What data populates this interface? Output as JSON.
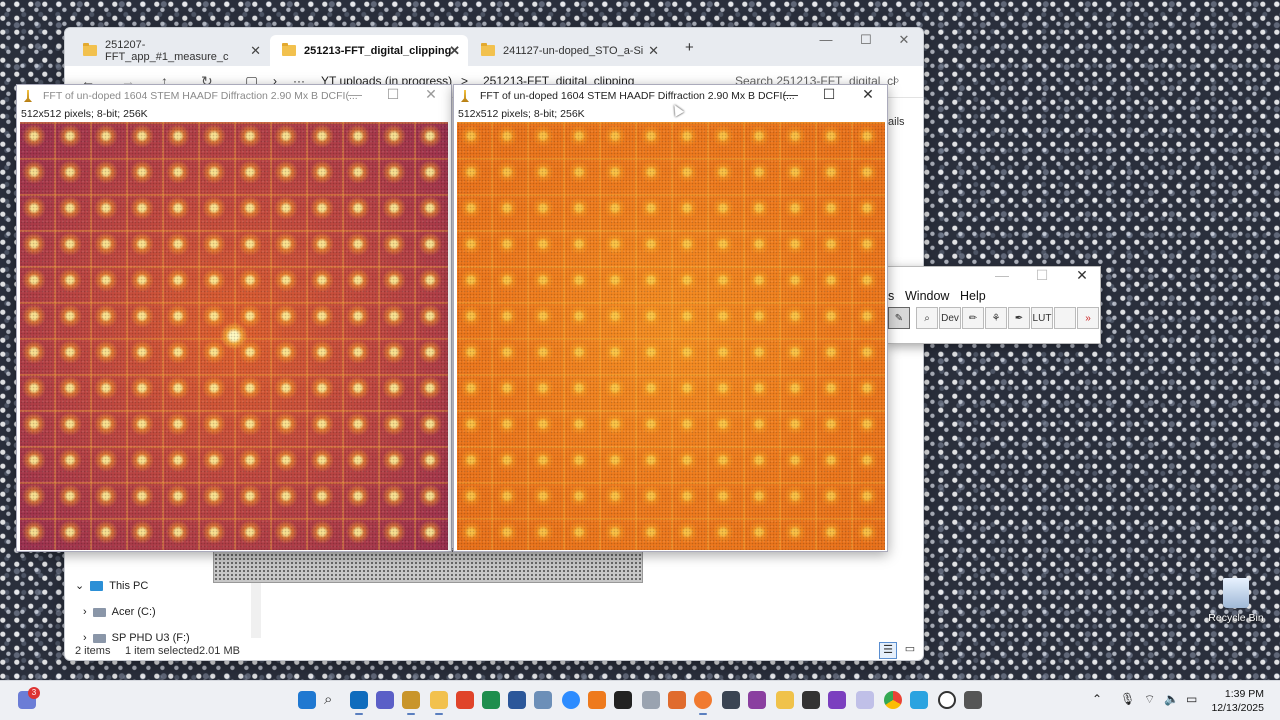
{
  "explorer": {
    "tabs": [
      {
        "label": "251207-FFT_app_#1_measure_c",
        "active": false
      },
      {
        "label": "251213-FFT_digital_clipping",
        "active": true
      },
      {
        "label": "241127-un-doped_STO_a-Si",
        "active": false
      }
    ],
    "new_tab": "+",
    "breadcrumb": [
      "YT uploads (in progress)",
      "251213-FFT_digital_clipping"
    ],
    "breadcrumb_sep": ">",
    "more": "···",
    "search_placeholder": "Search 251213-FFT_digital_cl",
    "details_label": "tails",
    "tree": [
      {
        "label": "This PC",
        "icon": "pc-icon"
      },
      {
        "label": "Acer (C:)",
        "icon": "drive-icon"
      },
      {
        "label": "SP PHD U3 (F:)",
        "icon": "drive-icon"
      }
    ],
    "status": {
      "items": "2 items",
      "selected": "1 item selected",
      "size": "2.01 MB"
    }
  },
  "fft_windows": [
    {
      "title": "FFT of un-doped 1604 STEM HAADF Diffraction 2.90 Mx B DCFI(...",
      "info": "512x512 pixels; 8-bit; 256K",
      "lut": "fire",
      "focused": false
    },
    {
      "title": "FFT of un-doped 1604 STEM HAADF Diffraction 2.90 Mx B DCFI(...",
      "info": "512x512 pixels; 8-bit; 256K",
      "lut": "orange",
      "focused": true
    }
  ],
  "imagej": {
    "menus": [
      "s",
      "Window",
      "Help"
    ],
    "tools": [
      "✎",
      "⌕",
      "Dev",
      "✏",
      "⚘",
      "✒",
      "LUT",
      "",
      "»"
    ]
  },
  "desktop": {
    "recycle_bin": "Recycle Bin"
  },
  "taskbar": {
    "notification_count": "3",
    "time": "1:39 PM",
    "date": "12/13/2025"
  },
  "colors": {
    "accent": "#005fb8",
    "fire_bg": "#b5404a",
    "orange_bg": "#ef7a1e",
    "taskbar_bg": "#eef0f4"
  }
}
